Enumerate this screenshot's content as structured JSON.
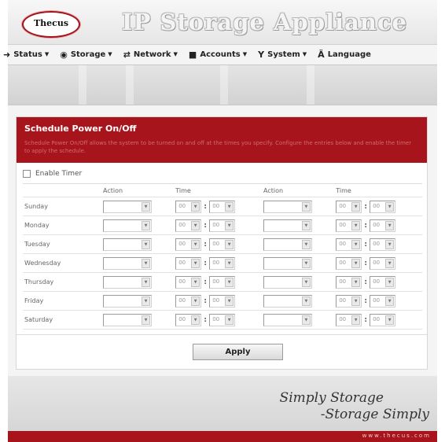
{
  "header": {
    "logo_text": "Thecus",
    "app_title": "IP Storage Appliance"
  },
  "nav": {
    "items": [
      {
        "label": "Status",
        "icon": "status-icon"
      },
      {
        "label": "Storage",
        "icon": "storage-icon"
      },
      {
        "label": "Network",
        "icon": "network-icon"
      },
      {
        "label": "Accounts",
        "icon": "accounts-icon"
      },
      {
        "label": "System",
        "icon": "system-icon"
      },
      {
        "label": "Language",
        "icon": "language-icon"
      }
    ]
  },
  "panel": {
    "title": "Schedule Power On/Off",
    "description": "Schedule Power On/Off allows the system to be turned on and off at the times you specify. Configure the entries below and enable the timer to apply the schedule."
  },
  "schedule": {
    "enable_timer_label": "Enable Timer",
    "enable_timer_checked": false,
    "columns": [
      "Action",
      "Time",
      "Action",
      "Time"
    ],
    "days": [
      "Sunday",
      "Monday",
      "Tuesday",
      "Wednesday",
      "Thursday",
      "Friday",
      "Saturday"
    ],
    "time_value": "00"
  },
  "apply_label": "Apply",
  "footer": {
    "slogan_line1": "Simply Storage",
    "slogan_line2": "-Storage Simply",
    "url": "www.thecus.com"
  },
  "colors": {
    "brand_red": "#a8141c",
    "background": "#f4f4f4"
  }
}
